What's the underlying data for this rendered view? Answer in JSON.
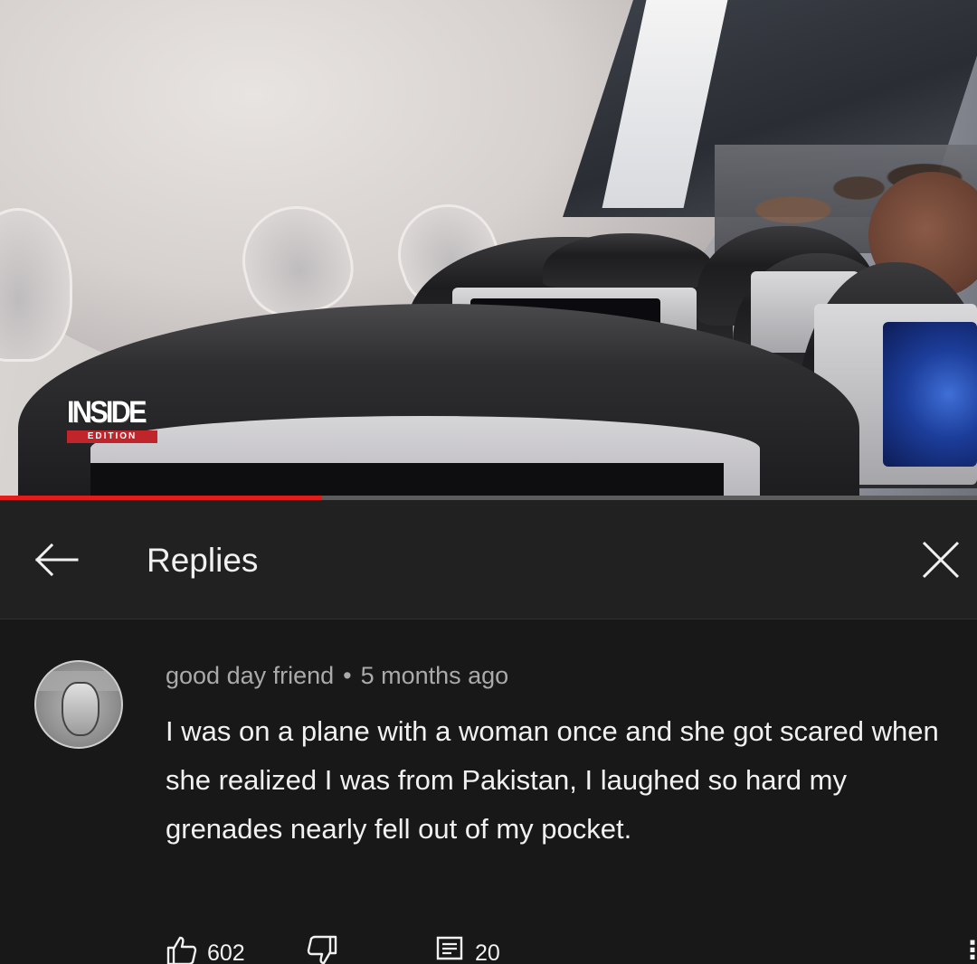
{
  "video": {
    "watermark": {
      "main": "INSIDE",
      "sub": "EDITION"
    },
    "progress_fraction": 0.33
  },
  "header": {
    "back_icon": "arrow-left-icon",
    "title": "Replies",
    "close_icon": "close-icon"
  },
  "comment": {
    "author": "good day friend",
    "separator": "•",
    "time": "5 months ago",
    "text": "I was on a plane with a woman once and she got scared when she realized I was from Pakistan, I laughed so hard my grenades nearly fell out of my pocket.",
    "like_count": "602",
    "reply_count": "20",
    "icons": {
      "like": "thumbs-up-icon",
      "dislike": "thumbs-down-icon",
      "reply": "comment-icon",
      "more": "more-vert-icon"
    },
    "more_glyph": "⋮"
  },
  "colors": {
    "background": "#181818",
    "header_bg": "#212121",
    "progress_red": "#e21b1b",
    "meta_gray": "#aaaaaa",
    "text": "#f1f1f1"
  }
}
